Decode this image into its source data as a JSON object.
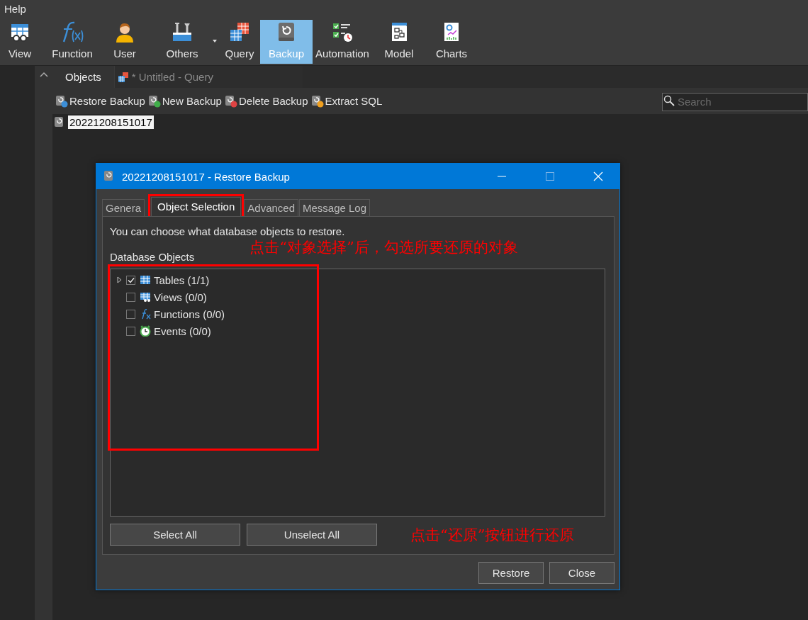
{
  "menu": [
    "Help"
  ],
  "toolbar": [
    {
      "label": "View",
      "kind": "view",
      "selected": false,
      "has_menu": false
    },
    {
      "label": "Function",
      "kind": "function",
      "selected": false,
      "has_menu": false
    },
    {
      "label": "User",
      "kind": "user",
      "selected": false,
      "has_menu": false
    },
    {
      "label": "Others",
      "kind": "others",
      "selected": false,
      "has_menu": true
    },
    {
      "label": "Query",
      "kind": "query",
      "selected": false,
      "has_menu": false
    },
    {
      "label": "Backup",
      "kind": "backup",
      "selected": true,
      "has_menu": false
    },
    {
      "label": "Automation",
      "kind": "automation",
      "selected": false,
      "has_menu": false
    },
    {
      "label": "Model",
      "kind": "model",
      "selected": false,
      "has_menu": false
    },
    {
      "label": "Charts",
      "kind": "charts",
      "selected": false,
      "has_menu": false
    }
  ],
  "document_tabs": [
    {
      "label": "Objects",
      "kind": "plain",
      "selected": true
    },
    {
      "label": "* Untitled - Query",
      "kind": "query",
      "selected": false
    }
  ],
  "object_toolbar": {
    "buttons": [
      {
        "label": "Restore Backup",
        "kind": "restore"
      },
      {
        "label": "New Backup",
        "kind": "new"
      },
      {
        "label": "Delete Backup",
        "kind": "delete"
      },
      {
        "label": "Extract SQL",
        "kind": "extract"
      }
    ],
    "search": {
      "placeholder": "Search"
    }
  },
  "backups": [
    {
      "name": "20221208151017",
      "selected": true
    }
  ],
  "dialog": {
    "title": "20221208151017 - Restore Backup",
    "tabs": [
      {
        "label": "Genera",
        "selected": false,
        "highlighted": false
      },
      {
        "label": "Object Selection",
        "selected": true,
        "highlighted": true
      },
      {
        "label": "Advanced",
        "selected": false,
        "highlighted": false
      },
      {
        "label": "Message Log",
        "selected": false,
        "highlighted": false
      }
    ],
    "description": "You can choose what database objects to restore.",
    "tree_label": "Database Objects",
    "tree_highlighted": true,
    "tree": [
      {
        "label": "Tables (1/1)",
        "kind": "tables",
        "checked": true,
        "expandable": true
      },
      {
        "label": "Views (0/0)",
        "kind": "views",
        "checked": false,
        "expandable": false
      },
      {
        "label": "Functions (0/0)",
        "kind": "functions",
        "checked": false,
        "expandable": false
      },
      {
        "label": "Events (0/0)",
        "kind": "events",
        "checked": false,
        "expandable": false
      }
    ],
    "panel_buttons": [
      "Select All",
      "Unselect All"
    ],
    "buttons": [
      "Restore",
      "Close"
    ],
    "notes": [
      "点击“对象选择”后，勾选所要还原的对象",
      "点击“还原”按钮进行还原"
    ]
  }
}
